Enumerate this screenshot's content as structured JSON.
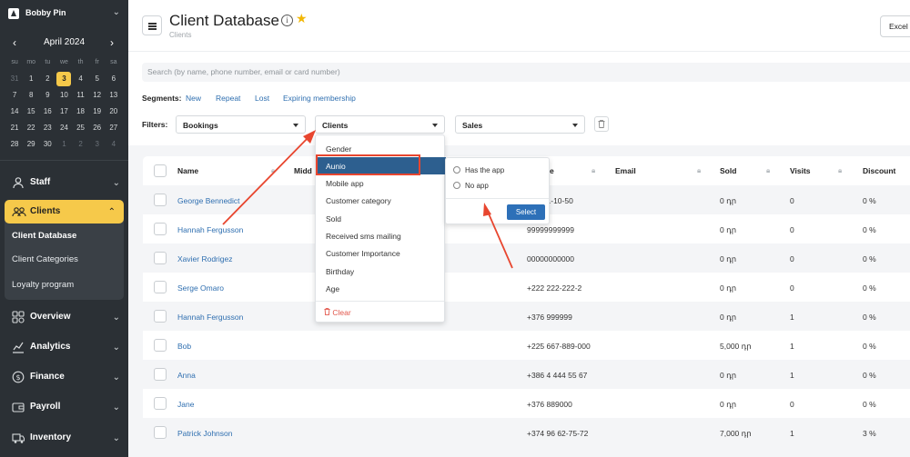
{
  "user": {
    "name": "Bobby Pin"
  },
  "calendar": {
    "title": "April 2024",
    "dows": [
      "su",
      "mo",
      "tu",
      "we",
      "th",
      "fr",
      "sa"
    ],
    "weeks": [
      [
        "31",
        "1",
        "2",
        "3",
        "4",
        "5",
        "6"
      ],
      [
        "7",
        "8",
        "9",
        "10",
        "11",
        "12",
        "13"
      ],
      [
        "14",
        "15",
        "16",
        "17",
        "18",
        "19",
        "20"
      ],
      [
        "21",
        "22",
        "23",
        "24",
        "25",
        "26",
        "27"
      ],
      [
        "28",
        "29",
        "30",
        "1",
        "2",
        "3",
        "4"
      ]
    ],
    "today": "3"
  },
  "nav": {
    "staff": "Staff",
    "clients": "Clients",
    "client_database": "Client Database",
    "client_categories": "Client Categories",
    "loyalty_program": "Loyalty program",
    "overview": "Overview",
    "analytics": "Analytics",
    "finance": "Finance",
    "payroll": "Payroll",
    "inventory": "Inventory"
  },
  "header": {
    "title": "Client Database",
    "breadcrumb": "Clients",
    "excel": "Excel export"
  },
  "search": {
    "placeholder": "Search (by name, phone number, email or card number)"
  },
  "segments": {
    "label": "Segments:",
    "items": [
      "New",
      "Repeat",
      "Lost",
      "Expiring membership"
    ]
  },
  "filters": {
    "label": "Filters:",
    "bookings": "Bookings",
    "clients": "Clients",
    "sales": "Sales"
  },
  "table": {
    "headers": {
      "name": "Name",
      "middle": "Midd",
      "phone": "e",
      "email": "Email",
      "sold": "Sold",
      "visits": "Visits",
      "discount": "Discount"
    },
    "rows": [
      {
        "name": "George Bennedict",
        "phone": "+93 31-10-50",
        "sold": "0 դր",
        "visits": "0",
        "discount": "0 %"
      },
      {
        "name": "Hannah Fergusson",
        "phone": "99999999999",
        "sold": "0 դր",
        "visits": "0",
        "discount": "0 %"
      },
      {
        "name": "Xavier Rodrigez",
        "phone": "00000000000",
        "sold": "0 դր",
        "visits": "0",
        "discount": "0 %"
      },
      {
        "name": "Serge Omaro",
        "phone": "+222 222-222-2",
        "sold": "0 դր",
        "visits": "0",
        "discount": "0 %"
      },
      {
        "name": "Hannah Fergusson",
        "phone": "+376 999999",
        "sold": "0 դր",
        "visits": "1",
        "discount": "0 %"
      },
      {
        "name": "Bob",
        "phone": "+225 667-889-000",
        "sold": "5,000 դր",
        "visits": "1",
        "discount": "0 %"
      },
      {
        "name": "Anna",
        "phone": "+386 4 444 55 67",
        "sold": "0 դր",
        "visits": "1",
        "discount": "0 %"
      },
      {
        "name": "Jane",
        "phone": "+376 889000",
        "sold": "0 դր",
        "visits": "0",
        "discount": "0 %"
      },
      {
        "name": "Patrick Johnson",
        "phone": "+374 96 62-75-72",
        "sold": "7,000 դր",
        "visits": "1",
        "discount": "3 %"
      }
    ]
  },
  "dropdown": {
    "items": [
      "Gender",
      "Aunio",
      "Mobile app",
      "Customer category",
      "Sold",
      "Received sms mailing",
      "Customer Importance",
      "Birthday",
      "Age"
    ],
    "clear": "Clear"
  },
  "submenu": {
    "options": [
      "Has the app",
      "No app"
    ],
    "select": "Select"
  },
  "colors": {
    "sidebar": "#2b3035",
    "accent": "#f6c94a",
    "link": "#2f6fb0",
    "highlight": "#2d5f8f",
    "annotation": "#e8462f"
  }
}
